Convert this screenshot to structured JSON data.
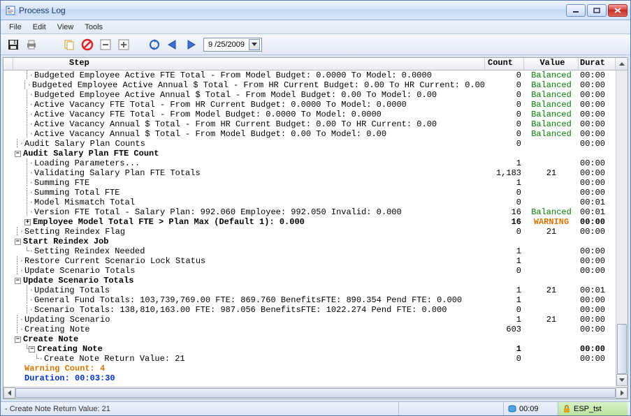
{
  "window": {
    "title": "Process Log"
  },
  "menus": [
    "File",
    "Edit",
    "View",
    "Tools"
  ],
  "toolbar": {
    "date_value": "9 /25/2009"
  },
  "grid": {
    "headers": {
      "step": "Step",
      "count": "Count",
      "value": "Value",
      "durat": "Durat"
    },
    "rows": [
      {
        "indent": 2,
        "glyph": "dots",
        "text": "Budgeted Employee Active FTE Total - From Model Budget: 0.0000 To Model: 0.0000",
        "count": "0",
        "value": "Balanced",
        "value_cls": "balanced",
        "durat": "00:00"
      },
      {
        "indent": 2,
        "glyph": "dots",
        "text": "Budgeted Employee Active Annual $ Total - From HR Current Budget: 0.00 To HR Current: 0.00",
        "count": "0",
        "value": "Balanced",
        "value_cls": "balanced",
        "durat": "00:00"
      },
      {
        "indent": 2,
        "glyph": "dots",
        "text": "Budgeted Employee Active Annual $ Total - From Model Budget: 0.00 To Model: 0.00",
        "count": "0",
        "value": "Balanced",
        "value_cls": "balanced",
        "durat": "00:00"
      },
      {
        "indent": 2,
        "glyph": "dots",
        "text": "Active Vacancy FTE Total - From HR Current Budget: 0.0000 To Model: 0.0000",
        "count": "0",
        "value": "Balanced",
        "value_cls": "balanced",
        "durat": "00:00"
      },
      {
        "indent": 2,
        "glyph": "dots",
        "text": "Active Vacancy FTE Total - From Model Budget: 0.0000 To Model: 0.0000",
        "count": "0",
        "value": "Balanced",
        "value_cls": "balanced",
        "durat": "00:00"
      },
      {
        "indent": 2,
        "glyph": "dots",
        "text": "Active Vacancy Annual $ Total - From HR Current Budget: 0.00  To HR Current: 0.00",
        "count": "0",
        "value": "Balanced",
        "value_cls": "balanced",
        "durat": "00:00"
      },
      {
        "indent": 2,
        "glyph": "dots",
        "text": "Active Vacancy Annual $ Total - From Model Budget: 0.00  To Model: 0.00",
        "count": "0",
        "value": "Balanced",
        "value_cls": "balanced",
        "durat": "00:00"
      },
      {
        "indent": 1,
        "glyph": "dots",
        "text": "Audit Salary Plan Counts",
        "count": "0",
        "value": "",
        "durat": "00:00"
      },
      {
        "indent": 1,
        "glyph": "minus",
        "text": "Audit Salary Plan FTE Count",
        "bold": true,
        "count": "",
        "value": "",
        "durat": ""
      },
      {
        "indent": 2,
        "glyph": "dots",
        "text": "Loading Parameters...",
        "count": "1",
        "value": "",
        "durat": "00:00"
      },
      {
        "indent": 2,
        "glyph": "dots",
        "text": "Validating Salary Plan FTE Totals",
        "count": "1,183",
        "value": "21",
        "durat": "00:00"
      },
      {
        "indent": 2,
        "glyph": "dots",
        "text": "Summing FTE",
        "count": "1",
        "value": "",
        "durat": "00:00"
      },
      {
        "indent": 2,
        "glyph": "dots",
        "text": "Summing Total FTE",
        "count": "0",
        "value": "",
        "durat": "00:00"
      },
      {
        "indent": 2,
        "glyph": "dots",
        "text": "Model Mismatch Total",
        "count": "0",
        "value": "",
        "durat": "00:01"
      },
      {
        "indent": 2,
        "glyph": "dots",
        "text": "Version FTE Total - Salary Plan: 992.060  Employee: 992.050  Invalid: 0.000",
        "count": "16",
        "value": "Balanced",
        "value_cls": "balanced",
        "durat": "00:01"
      },
      {
        "indent": 2,
        "glyph": "plus",
        "text": "Employee Model Total FTE > Plan Max (Default 1): 0.000",
        "bold": true,
        "count": "16",
        "value": "WARNING",
        "value_cls": "warning-val",
        "durat": "00:00"
      },
      {
        "indent": 1,
        "glyph": "dots",
        "text": "Setting Reindex Flag",
        "count": "0",
        "value": "21",
        "durat": "00:00"
      },
      {
        "indent": 1,
        "glyph": "minus",
        "text": "Start Reindex Job",
        "bold": true,
        "count": "",
        "value": "",
        "durat": ""
      },
      {
        "indent": 2,
        "glyph": "end",
        "text": "Setting Reindex Needed",
        "count": "1",
        "value": "",
        "durat": "00:00"
      },
      {
        "indent": 1,
        "glyph": "dots",
        "text": "Restore Current Scenario Lock Status",
        "count": "1",
        "value": "",
        "durat": "00:00"
      },
      {
        "indent": 1,
        "glyph": "dots",
        "text": "Update Scenario Totals",
        "count": "0",
        "value": "",
        "durat": "00:00"
      },
      {
        "indent": 1,
        "glyph": "minus",
        "text": "Update Scenario Totals",
        "bold": true,
        "count": "",
        "value": "",
        "durat": ""
      },
      {
        "indent": 2,
        "glyph": "dots",
        "text": "Updating Totals",
        "count": "1",
        "value": "21",
        "durat": "00:01"
      },
      {
        "indent": 2,
        "glyph": "dots",
        "text": "General Fund Totals: 103,739,769.00  FTE: 869.760  BenefitsFTE: 890.354  Pend FTE: 0.000",
        "count": "1",
        "value": "",
        "durat": "00:00"
      },
      {
        "indent": 2,
        "glyph": "dots",
        "text": "Scenario Totals: 138,810,163.00  FTE: 987.056  BenefitsFTE: 1022.274  Pend FTE: 0.000",
        "count": "0",
        "value": "",
        "durat": "00:00"
      },
      {
        "indent": 1,
        "glyph": "dots",
        "text": "Updating Scenario",
        "count": "1",
        "value": "21",
        "durat": "00:00"
      },
      {
        "indent": 1,
        "glyph": "dots",
        "text": "Creating Note",
        "count": "603",
        "value": "",
        "durat": "00:00"
      },
      {
        "indent": 1,
        "glyph": "minus",
        "text": "Create Note",
        "bold": true,
        "count": "",
        "value": "",
        "durat": ""
      },
      {
        "indent": 2,
        "glyph": "minusend",
        "text": "Creating Note",
        "bold": true,
        "count": "1",
        "value": "",
        "durat": "00:00",
        "durat_bold": true
      },
      {
        "indent": 3,
        "glyph": "end",
        "text": "Create Note Return Value: 21",
        "count": "0",
        "value": "",
        "durat": "00:00"
      },
      {
        "indent": 1,
        "glyph": "none",
        "text": "Warning Count: 4",
        "text_cls": "warning-orange",
        "count": "",
        "value": "",
        "durat": ""
      },
      {
        "indent": 1,
        "glyph": "none",
        "text": "Duration: 00:03:30",
        "text_cls": "blue-dur",
        "count": "",
        "value": "",
        "durat": ""
      }
    ]
  },
  "status": {
    "left": "- Create Note Return Value: 21",
    "time": "00:09",
    "db": "ESP_tst"
  }
}
